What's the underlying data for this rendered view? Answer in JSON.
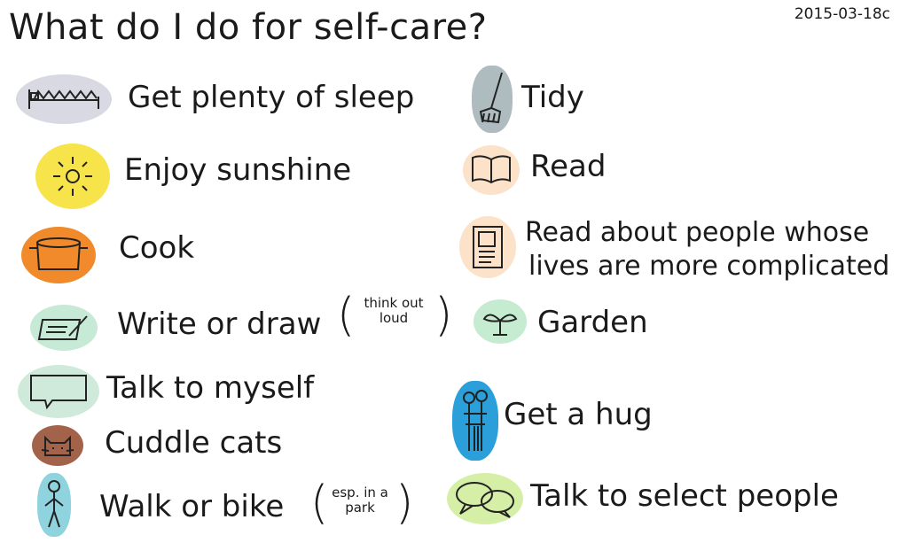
{
  "title": "What do I do for self-care?",
  "date": "2015-03-18c",
  "left_items": [
    {
      "label": "Get plenty of sleep",
      "icon": "bed-icon",
      "color": "#d9d9e3"
    },
    {
      "label": "Enjoy sunshine",
      "icon": "sun-icon",
      "color": "#f7e34a"
    },
    {
      "label": "Cook",
      "icon": "pot-icon",
      "color": "#f08a2a"
    },
    {
      "label": "Write or draw",
      "aside": "think out loud",
      "icon": "pen-paper-icon",
      "color": "#c7ead7"
    },
    {
      "label": "Talk to myself",
      "icon": "speech-bubble-icon",
      "color": "#cfe9da"
    },
    {
      "label": "Cuddle cats",
      "icon": "cat-icon",
      "color": "#a3634a"
    },
    {
      "label": "Walk or bike",
      "aside": "esp. in a park",
      "icon": "walking-person-icon",
      "color": "#8fd3de"
    }
  ],
  "right_items": [
    {
      "label": "Tidy",
      "icon": "broom-icon",
      "color": "#aebcbf"
    },
    {
      "label": "Read",
      "icon": "book-icon",
      "color": "#fbe2c9"
    },
    {
      "label": "Read about people whose lives are more complicated",
      "line1": "Read about people whose",
      "line2": "lives are more complicated",
      "icon": "biography-book-icon",
      "color": "#fbe2c9"
    },
    {
      "label": "Garden",
      "icon": "sprout-icon",
      "color": "#c5ecd0"
    },
    {
      "label": "Get a hug",
      "icon": "hugging-people-icon",
      "color": "#2b9fd9"
    },
    {
      "label": "Talk to select people",
      "icon": "conversation-bubbles-icon",
      "color": "#d6efa6"
    }
  ]
}
